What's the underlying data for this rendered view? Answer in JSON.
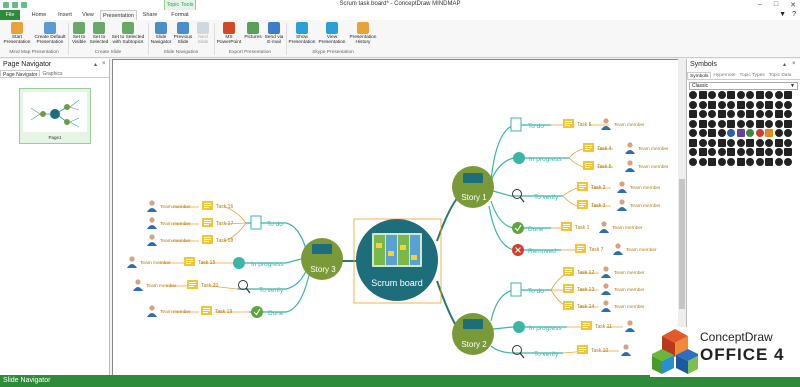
{
  "window": {
    "title": "Scrum task board* - ConceptDraw MINDMAP",
    "context_tab": "Topic Tools"
  },
  "tabs": [
    "File",
    "Home",
    "Insert",
    "View",
    "Presentation",
    "Share",
    "Format"
  ],
  "ribbon": {
    "groups": [
      {
        "label": "Mind Map Presentation",
        "buttons": [
          "Start Presentation",
          "Create Default Presentation"
        ]
      },
      {
        "label": "Create Slide",
        "buttons": [
          "Set to Visible",
          "Set to Selected",
          "Set to Selected with Subtopics"
        ]
      },
      {
        "label": "Slide Navigation",
        "buttons": [
          "Slide Navigator",
          "Previous Slide",
          "Next Slide"
        ]
      },
      {
        "label": "Export Presentation",
        "buttons": [
          "MS PowerPoint",
          "Pictures",
          "Send via E-mail"
        ]
      },
      {
        "label": "Skype Presentation",
        "buttons": [
          "Show Presentation",
          "View Presentation",
          "Presentation History"
        ]
      }
    ]
  },
  "left_panel": {
    "title": "Page Navigator",
    "tabs": [
      "Page Navigator",
      "Graphics"
    ],
    "page_label": "Page1"
  },
  "right_panel": {
    "title": "Symbols",
    "tabs": [
      "Symbols",
      "Hypernote",
      "Topic Types",
      "Topic Data"
    ],
    "set_selected": "Classic"
  },
  "status": {
    "label": "Slide Navigator"
  },
  "logo": {
    "line1": "ConceptDraw",
    "line2": "OFFICE 4"
  },
  "mindmap": {
    "central": "Scrum board",
    "stories": {
      "story1": "Story 1",
      "story2": "Story 2",
      "story3": "Story 3"
    },
    "s1": {
      "todo": "To do",
      "inprog": "In progress",
      "verify": "To verify",
      "done": "Done",
      "removed": "Removed",
      "t6": "Task 6",
      "t4": "Task 4",
      "t5": "Task 5",
      "t2": "Task 2",
      "t3": "Task 3",
      "t1": "Task 1",
      "t7": "Task 7"
    },
    "s2": {
      "todo": "To do",
      "inprog": "In progress",
      "verify": "To verify",
      "t12": "Task 12",
      "t13": "Task 13",
      "t14": "Task 14",
      "t11": "Task 11",
      "t10": "Task 10"
    },
    "s3": {
      "todo": "To do",
      "inprog": "In progress",
      "verify": "To verify",
      "done": "Done",
      "t16": "Task 16",
      "t17": "Task 17",
      "t18": "Task 18",
      "t15": "Task 15",
      "t20": "Task 20",
      "t19": "Task 19"
    },
    "member": "Team member"
  }
}
